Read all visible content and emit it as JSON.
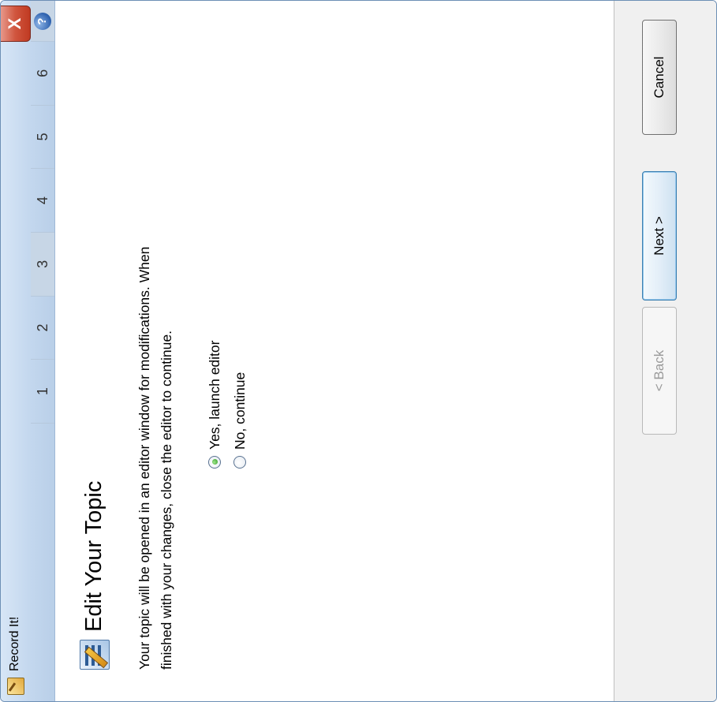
{
  "window": {
    "title": "Record It!",
    "close_label": "X"
  },
  "steps": {
    "items": [
      "1",
      "2",
      "3",
      "4",
      "5",
      "6"
    ],
    "active_index": 2
  },
  "help": {
    "label": "?"
  },
  "page": {
    "heading": "Edit Your Topic",
    "description": "Your topic will be opened in an editor window for modifications. When finished with your changes, close the editor to continue."
  },
  "options": [
    {
      "label": "Yes, launch editor",
      "checked": true
    },
    {
      "label": "No, continue",
      "checked": false
    }
  ],
  "buttons": {
    "back": "< Back",
    "next": "Next >",
    "cancel": "Cancel"
  },
  "icons": {
    "app": "record-it-icon",
    "topic": "edit-topic-icon",
    "help": "help-icon",
    "close": "close-icon"
  }
}
